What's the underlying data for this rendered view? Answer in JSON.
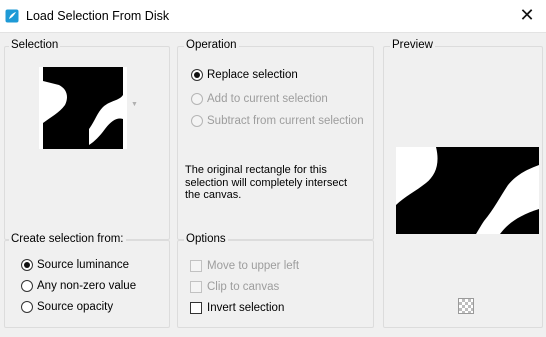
{
  "window": {
    "title": "Load Selection From Disk",
    "close_glyph": "✕"
  },
  "selection_group": {
    "label": "Selection"
  },
  "operation_group": {
    "label": "Operation",
    "options": [
      {
        "label": "Replace selection",
        "selected": true,
        "enabled": true
      },
      {
        "label": "Add to current selection",
        "selected": false,
        "enabled": false
      },
      {
        "label": "Subtract from current selection",
        "selected": false,
        "enabled": false
      }
    ],
    "note_lines": [
      "The original rectangle for this",
      "selection will completely intersect",
      "the canvas."
    ]
  },
  "preview_group": {
    "label": "Preview"
  },
  "create_group": {
    "label": "Create selection from:",
    "options": [
      {
        "label": "Source luminance",
        "selected": true
      },
      {
        "label": "Any non-zero value",
        "selected": false
      },
      {
        "label": "Source opacity",
        "selected": false
      }
    ]
  },
  "options_group": {
    "label": "Options",
    "checks": [
      {
        "label": "Move to upper left",
        "checked": false,
        "enabled": false
      },
      {
        "label": "Clip to canvas",
        "checked": false,
        "enabled": false
      },
      {
        "label": "Invert selection",
        "checked": false,
        "enabled": true
      }
    ]
  },
  "icons": {
    "app": "psp-app-icon",
    "preview_toggle": "checkerboard-icon",
    "dropdown": "chevron-down-icon"
  },
  "colors": {
    "dialog_bg": "#f0f0f0",
    "group_border": "#dcdcdc",
    "disabled_text": "#9d9d9d",
    "app_icon": "#1e9ad6"
  }
}
